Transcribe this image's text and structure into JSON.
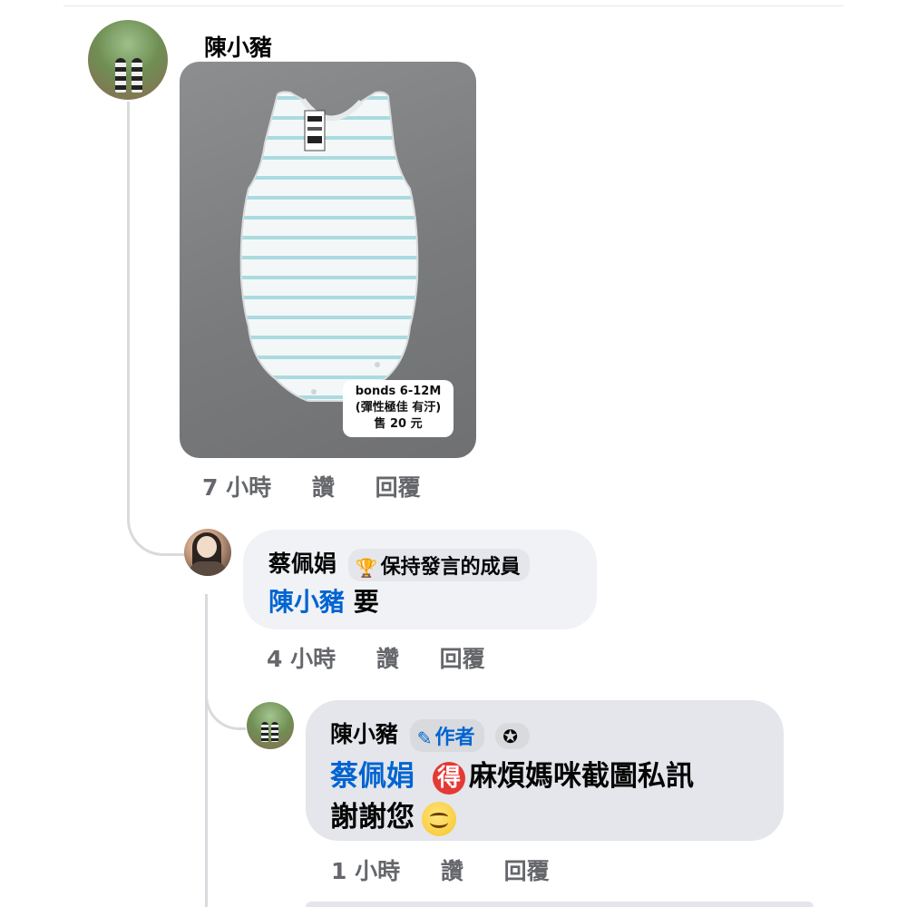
{
  "comment": {
    "author": "陳小豬",
    "photo": {
      "alt": "striped baby bodysuit",
      "tag_lines": [
        "bonds 6-12M",
        "(彈性極佳 有汙)",
        "售 20 元"
      ]
    },
    "time": "7 小時",
    "like_label": "讚",
    "reply_label": "回覆"
  },
  "reply1": {
    "author": "蔡佩娟",
    "badge_icon": "trophy-icon",
    "badge_label": "保持發言的成員",
    "mention": "陳小豬",
    "text": "要",
    "time": "4 小時",
    "like_label": "讚",
    "reply_label": "回覆"
  },
  "reply2": {
    "author": "陳小豬",
    "author_badge_icon": "pencil-icon",
    "author_badge_label": "作者",
    "second_badge_icon": "award-badge-icon",
    "mention": "蔡佩娟",
    "emoji_de": "得",
    "text_line1": "麻煩媽咪截圖私訊",
    "text_line2": "謝謝您",
    "emoji_smile": "smiling-face-icon",
    "time": "1 小時",
    "like_label": "讚",
    "reply_label": "回覆"
  },
  "colors": {
    "mention": "#0064d1",
    "meta_text": "#65676b",
    "bubble_light": "#f0f2f5",
    "bubble_author": "#e4e6eb",
    "emoji_de_bg": "#e53935"
  }
}
